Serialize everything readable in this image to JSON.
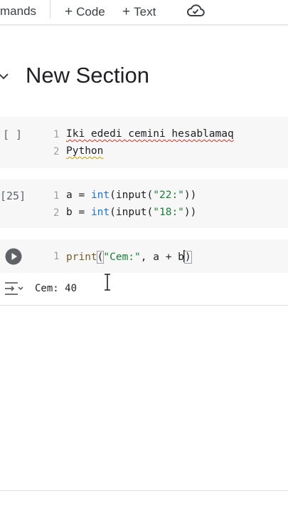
{
  "toolbar": {
    "commands_partial": "mands",
    "add_code": "Code",
    "add_text": "Text",
    "plus_symbol": "+",
    "cloud_icon": "cloud-save-icon"
  },
  "section": {
    "title": "New Section",
    "chevron_icon": "chevron-down-icon"
  },
  "cells": [
    {
      "exec_count": "[ ]",
      "lines": [
        {
          "number": "1",
          "text": "Iki ededi cemini hesablamaq"
        },
        {
          "number": "2",
          "text": "Python"
        }
      ]
    },
    {
      "exec_count": "[25]",
      "lines": [
        {
          "number": "1",
          "var": "a",
          "eq": " = ",
          "fn": "int",
          "open": "(",
          "inner_fn": "input",
          "arg": "\"22:\"",
          "close": "))"
        },
        {
          "number": "2",
          "var": "b",
          "eq": " = ",
          "fn": "int",
          "open": "(",
          "inner_fn": "input",
          "arg": "\"18:\"",
          "close": "))"
        }
      ]
    },
    {
      "run_icon": "play-icon",
      "lines": [
        {
          "number": "1",
          "fn": "print",
          "open": "(",
          "arg": "\"Cem:\"",
          "rest": ", a + b",
          "close": ")"
        }
      ]
    }
  ],
  "output": {
    "icon": "output-toggle-icon",
    "text": "Cem: 40"
  },
  "colors": {
    "accent_blue": "#1a73e8",
    "string_green": "#188038",
    "cell_bg": "#f7f7f7",
    "error_squiggle": "#d93025"
  }
}
